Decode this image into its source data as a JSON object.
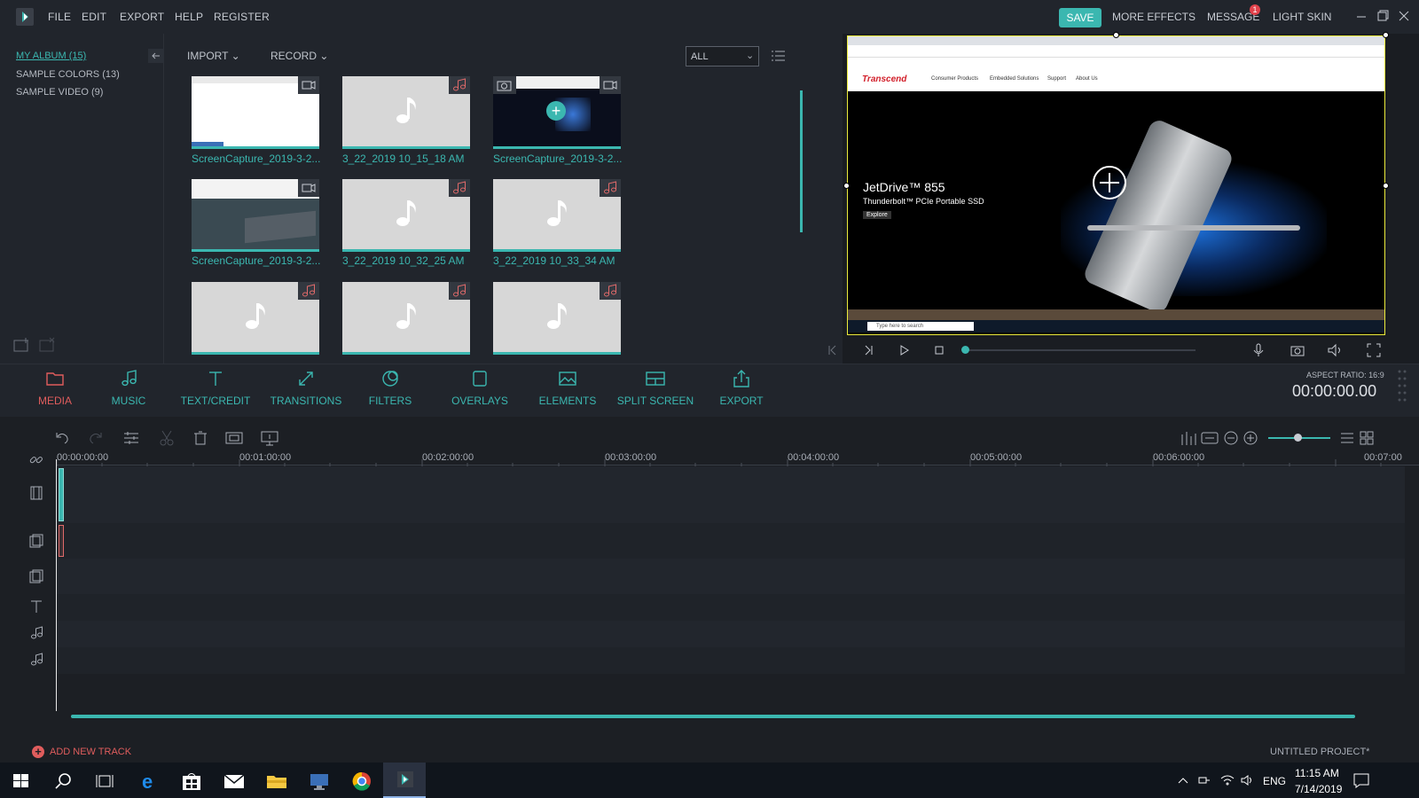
{
  "menu": {
    "file": "FILE",
    "edit": "EDIT",
    "export": "EXPORT",
    "help": "HELP",
    "register": "REGISTER"
  },
  "topbar": {
    "save": "SAVE",
    "more_effects": "MORE EFFECTS",
    "message": "MESSAGE",
    "message_count": "1",
    "light_skin": "LIGHT SKIN"
  },
  "album": {
    "items": [
      {
        "label": "MY ALBUM (15)"
      },
      {
        "label": "SAMPLE COLORS (13)"
      },
      {
        "label": "SAMPLE VIDEO (9)"
      }
    ]
  },
  "media": {
    "import_label": "IMPORT",
    "record_label": "RECORD",
    "filter_value": "ALL",
    "tiles": [
      {
        "label": "ScreenCapture_2019-3-2...",
        "kind": "video"
      },
      {
        "label": "3_22_2019 10_15_18 AM",
        "kind": "audio"
      },
      {
        "label": "ScreenCapture_2019-3-2...",
        "kind": "video"
      },
      {
        "label": "ScreenCapture_2019-3-2...",
        "kind": "video"
      },
      {
        "label": "3_22_2019 10_32_25 AM",
        "kind": "audio"
      },
      {
        "label": "3_22_2019 10_33_34 AM",
        "kind": "audio"
      },
      {
        "label": "",
        "kind": "audio"
      },
      {
        "label": "",
        "kind": "audio"
      },
      {
        "label": "",
        "kind": "audio"
      }
    ]
  },
  "preview": {
    "site_brand": "Transcend",
    "nav": [
      "Consumer Products",
      "Embedded Solutions",
      "Support",
      "About Us"
    ],
    "hero_title": "JetDrive™ 855",
    "hero_subtitle": "Thunderbolt™ PCIe Portable SSD",
    "hero_button": "Explore",
    "taskbar_search": "Type here to search"
  },
  "tabs": [
    {
      "label": "MEDIA",
      "icon": "folder-icon"
    },
    {
      "label": "MUSIC",
      "icon": "music-note-icon"
    },
    {
      "label": "TEXT/CREDIT",
      "icon": "text-icon"
    },
    {
      "label": "TRANSITIONS",
      "icon": "transitions-icon"
    },
    {
      "label": "FILTERS",
      "icon": "filters-icon"
    },
    {
      "label": "OVERLAYS",
      "icon": "overlays-icon"
    },
    {
      "label": "ELEMENTS",
      "icon": "elements-icon"
    },
    {
      "label": "SPLIT SCREEN",
      "icon": "split-screen-icon"
    },
    {
      "label": "EXPORT",
      "icon": "export-icon"
    }
  ],
  "player": {
    "aspect_ratio": "ASPECT RATIO: 16:9",
    "timecode": "00:00:00.00"
  },
  "timeline": {
    "ruler": [
      "00:00:00:00",
      "00:01:00:00",
      "00:02:00:00",
      "00:03:00:00",
      "00:04:00:00",
      "00:05:00:00",
      "00:06:00:00",
      "00:07:00"
    ]
  },
  "footer": {
    "add_track": "ADD NEW TRACK",
    "project_name": "UNTITLED PROJECT*"
  },
  "taskbar": {
    "lang": "ENG",
    "time": "11:15 AM",
    "date": "7/14/2019"
  },
  "colors": {
    "accent": "#3bb7b0",
    "background": "#21252c",
    "timeline_bg": "#1c1f24",
    "audio_icon": "#e06a6a"
  }
}
